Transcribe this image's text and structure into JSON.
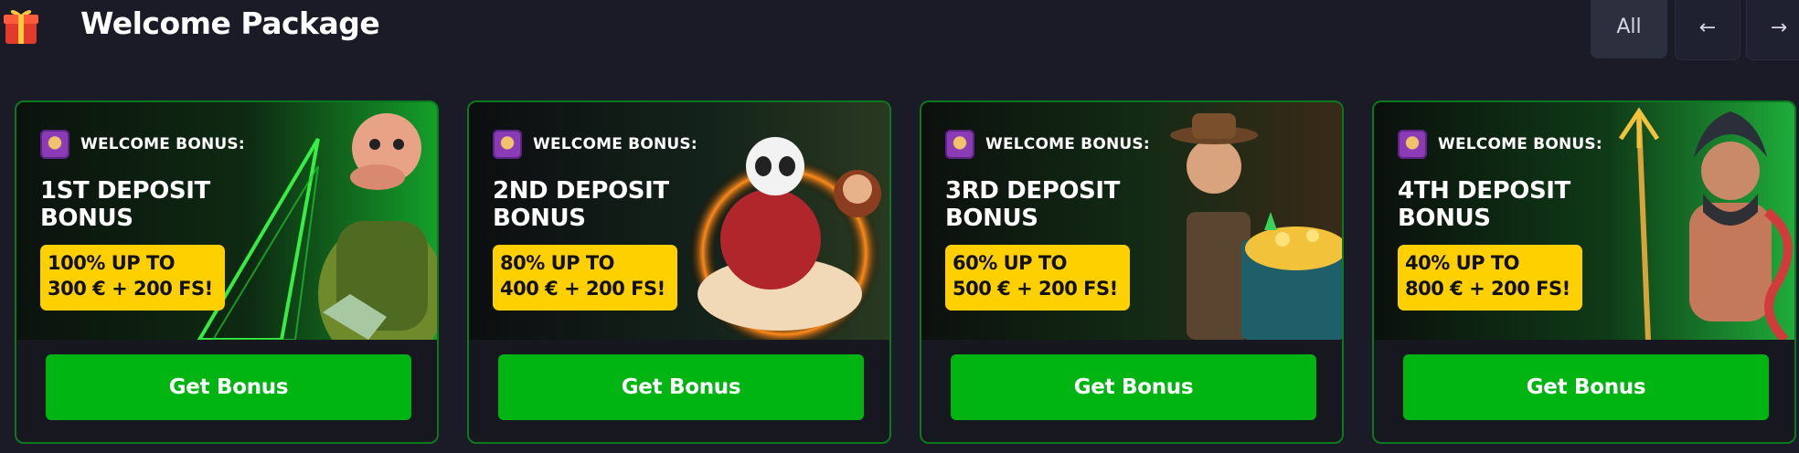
{
  "header": {
    "title": "Welcome Package",
    "gift_icon": "gift-box-icon",
    "all_label": "All",
    "prev_icon": "arrow-left-icon",
    "next_icon": "arrow-right-icon",
    "prev_glyph": "←",
    "next_glyph": "→"
  },
  "colors": {
    "accent_green": "#00b512",
    "offer_yellow": "#ffd000",
    "card_border": "#0b7a1d",
    "background": "#1a1b26"
  },
  "cards": [
    {
      "badge": "WELCOME BONUS:",
      "title": "1ST DEPOSIT BONUS",
      "title_line1": "1ST DEPOSIT",
      "title_line2": "BONUS",
      "offer_line1": "100% UP TO",
      "offer_line2": "300 € + 200 FS!",
      "button": "Get Bonus",
      "art": "banker-character-illustration"
    },
    {
      "badge": "WELCOME BONUS:",
      "title": "2ND DEPOSIT BONUS",
      "title_line1": "2ND DEPOSIT",
      "title_line2": "BONUS",
      "offer_line1": "80% UP TO",
      "offer_line2": "400 € + 200 FS!",
      "button": "Get Bonus",
      "art": "panda-on-cloud-illustration"
    },
    {
      "badge": "WELCOME BONUS:",
      "title": "3RD DEPOSIT BONUS",
      "title_line1": "3RD DEPOSIT",
      "title_line2": "BONUS",
      "offer_line1": "60% UP TO",
      "offer_line2": "500 € + 200 FS!",
      "button": "Get Bonus",
      "art": "explorer-with-treasure-illustration"
    },
    {
      "badge": "WELCOME BONUS:",
      "title": "4TH DEPOSIT BONUS",
      "title_line1": "4TH DEPOSIT",
      "title_line2": "BONUS",
      "offer_line1": "40% UP TO",
      "offer_line2": "800 € + 200 FS!",
      "button": "Get Bonus",
      "art": "sea-king-with-trident-illustration"
    }
  ]
}
